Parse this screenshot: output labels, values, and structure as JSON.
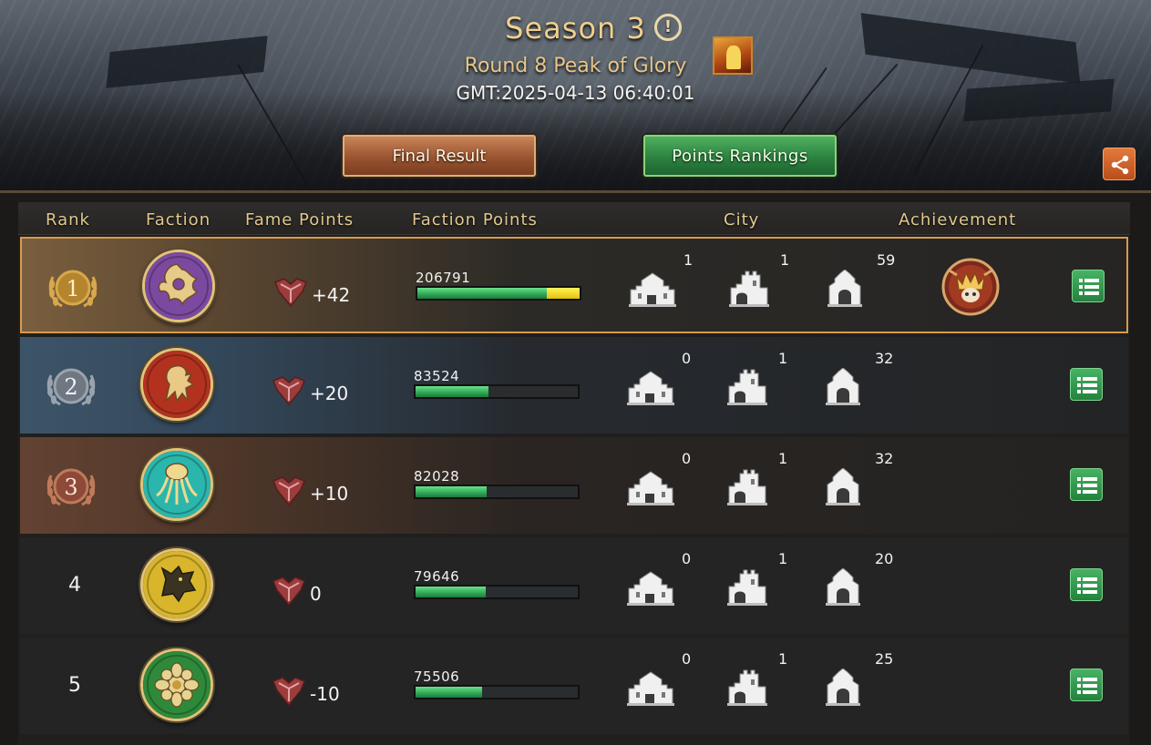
{
  "header": {
    "season_title": "Season 3",
    "round_title": "Round 8 Peak of Glory",
    "gmt_time": "GMT:2025-04-13 06:40:01",
    "final_result_label": "Final Result",
    "points_rankings_label": "Points Rankings",
    "active_tab": "Points Rankings"
  },
  "table": {
    "columns": [
      "Rank",
      "Faction",
      "Fame Points",
      "Faction Points",
      "City",
      "Achievement"
    ],
    "rows": [
      {
        "rank": "1",
        "faction_emblem": "dragon-sigil-icon",
        "emblem_color": "#7b4aa0",
        "fame": "+42",
        "faction_points": "206791",
        "fill": 0.8,
        "extra_fill": 0.2,
        "city_a": "1",
        "city_b": "1",
        "city_c": "59",
        "achievement": "skull-crown-badge-icon"
      },
      {
        "rank": "2",
        "faction_emblem": "lion-sigil-icon",
        "emblem_color": "#b2321f",
        "fame": "+20",
        "faction_points": "83524",
        "fill": 0.45,
        "extra_fill": 0,
        "city_a": "0",
        "city_b": "1",
        "city_c": "32",
        "achievement": ""
      },
      {
        "rank": "3",
        "faction_emblem": "kraken-sigil-icon",
        "emblem_color": "#2bb6ad",
        "fame": "+10",
        "faction_points": "82028",
        "fill": 0.44,
        "extra_fill": 0,
        "city_a": "0",
        "city_b": "1",
        "city_c": "32",
        "achievement": ""
      },
      {
        "rank": "4",
        "faction_emblem": "direwolf-sigil-icon",
        "emblem_color": "#d9b52c",
        "fame": "0",
        "faction_points": "79646",
        "fill": 0.43,
        "extra_fill": 0,
        "city_a": "0",
        "city_b": "1",
        "city_c": "20",
        "achievement": ""
      },
      {
        "rank": "5",
        "faction_emblem": "rose-sigil-icon",
        "emblem_color": "#2e8a3a",
        "fame": "-10",
        "faction_points": "75506",
        "fill": 0.41,
        "extra_fill": 0,
        "city_a": "0",
        "city_b": "1",
        "city_c": "25",
        "achievement": ""
      }
    ]
  },
  "colors": {
    "gold": "#e3c88e",
    "green_button": "#2c8240",
    "orange_button": "#9a5430",
    "bar_green": "#2ea655",
    "bar_yellow": "#f2dc1e"
  }
}
